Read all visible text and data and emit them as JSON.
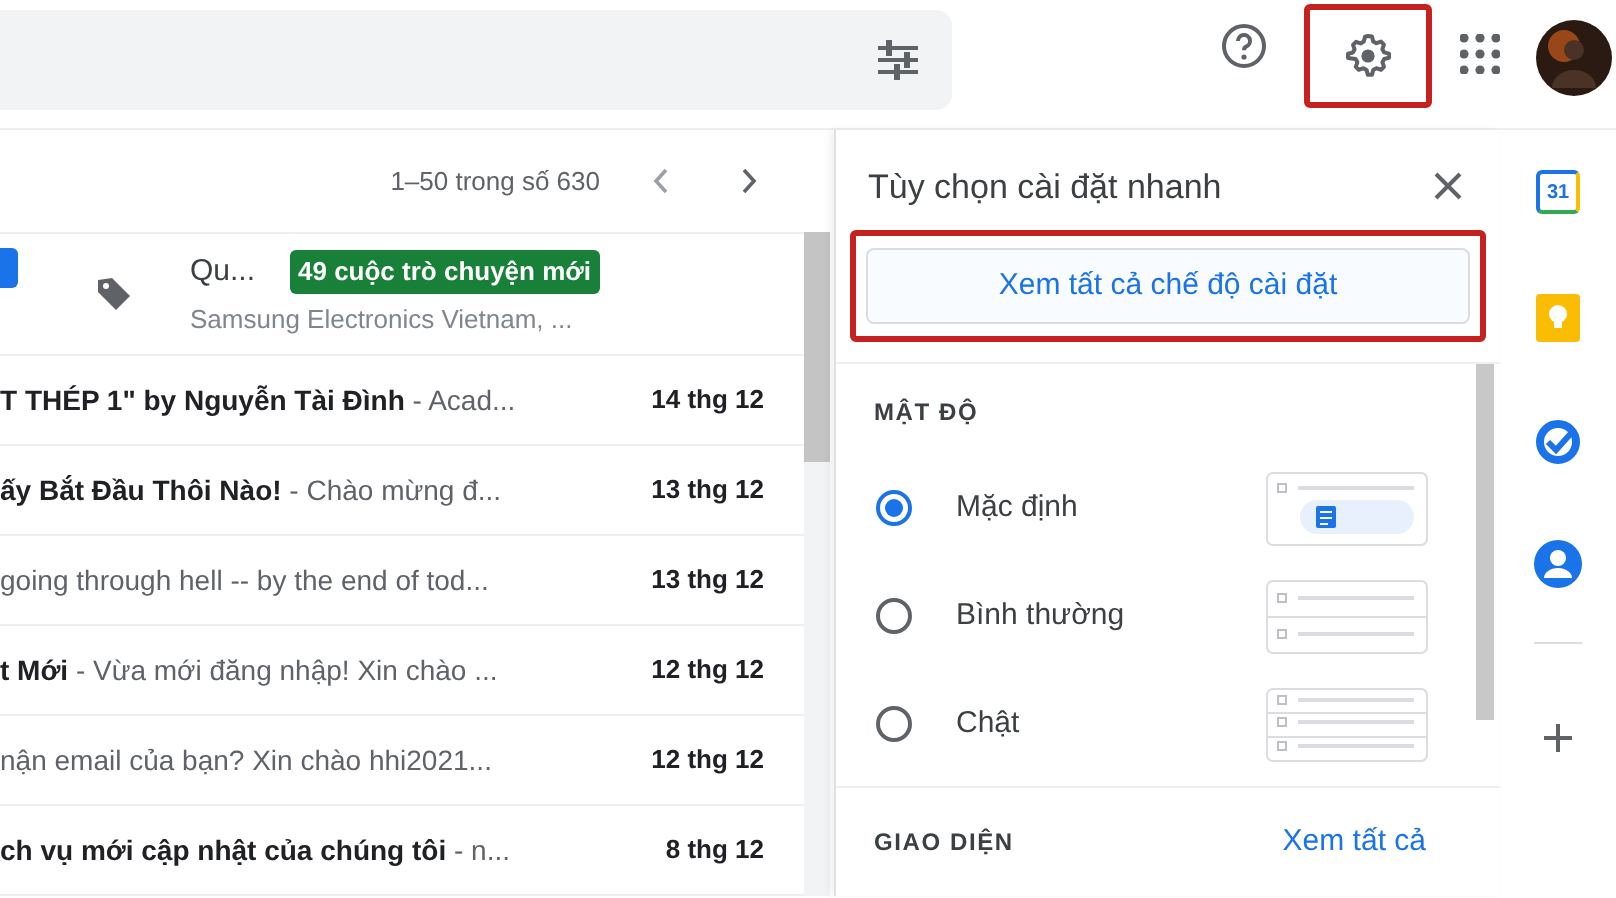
{
  "pagination": {
    "range": "1–50 trong số 630"
  },
  "promo_row": {
    "sender": "Qu...",
    "badge": "49 cuộc trò chuyện mới",
    "senders": "Samsung Electronics Vietnam, ..."
  },
  "emails": [
    {
      "subject": "T THÉP 1\" by Nguyễn Tài Đình",
      "snippet": " - Acad...",
      "date": "14 thg 12"
    },
    {
      "subject": "ấy Bắt Đầu Thôi Nào!",
      "snippet": " - Chào mừng đ...",
      "date": "13 thg 12"
    },
    {
      "snippet": "going through hell -- by the end of tod...",
      "date": "13 thg 12"
    },
    {
      "subject": "t Mới",
      "snippet": " - Vừa mới đăng nhập! Xin chào ...",
      "date": "12 thg 12"
    },
    {
      "snippet": "nận email của bạn? Xin chào hhi2021...",
      "date": "12 thg 12"
    },
    {
      "subject": "ch vụ mới cập nhật của chúng tôi",
      "snippet": " - n...",
      "date": "8 thg 12"
    }
  ],
  "quick_settings": {
    "title": "Tùy chọn cài đặt nhanh",
    "all_settings_button": "Xem tất cả chế độ cài đặt",
    "density": {
      "heading": "MẬT ĐỘ",
      "options": [
        {
          "label": "Mặc định",
          "selected": true,
          "kind": "default"
        },
        {
          "label": "Bình thường",
          "selected": false,
          "kind": "comfortable"
        },
        {
          "label": "Chật",
          "selected": false,
          "kind": "compact"
        }
      ]
    },
    "theme": {
      "heading": "GIAO DIỆN",
      "link": "Xem tất cả"
    }
  },
  "side_panel": {
    "calendar_day": "31"
  }
}
